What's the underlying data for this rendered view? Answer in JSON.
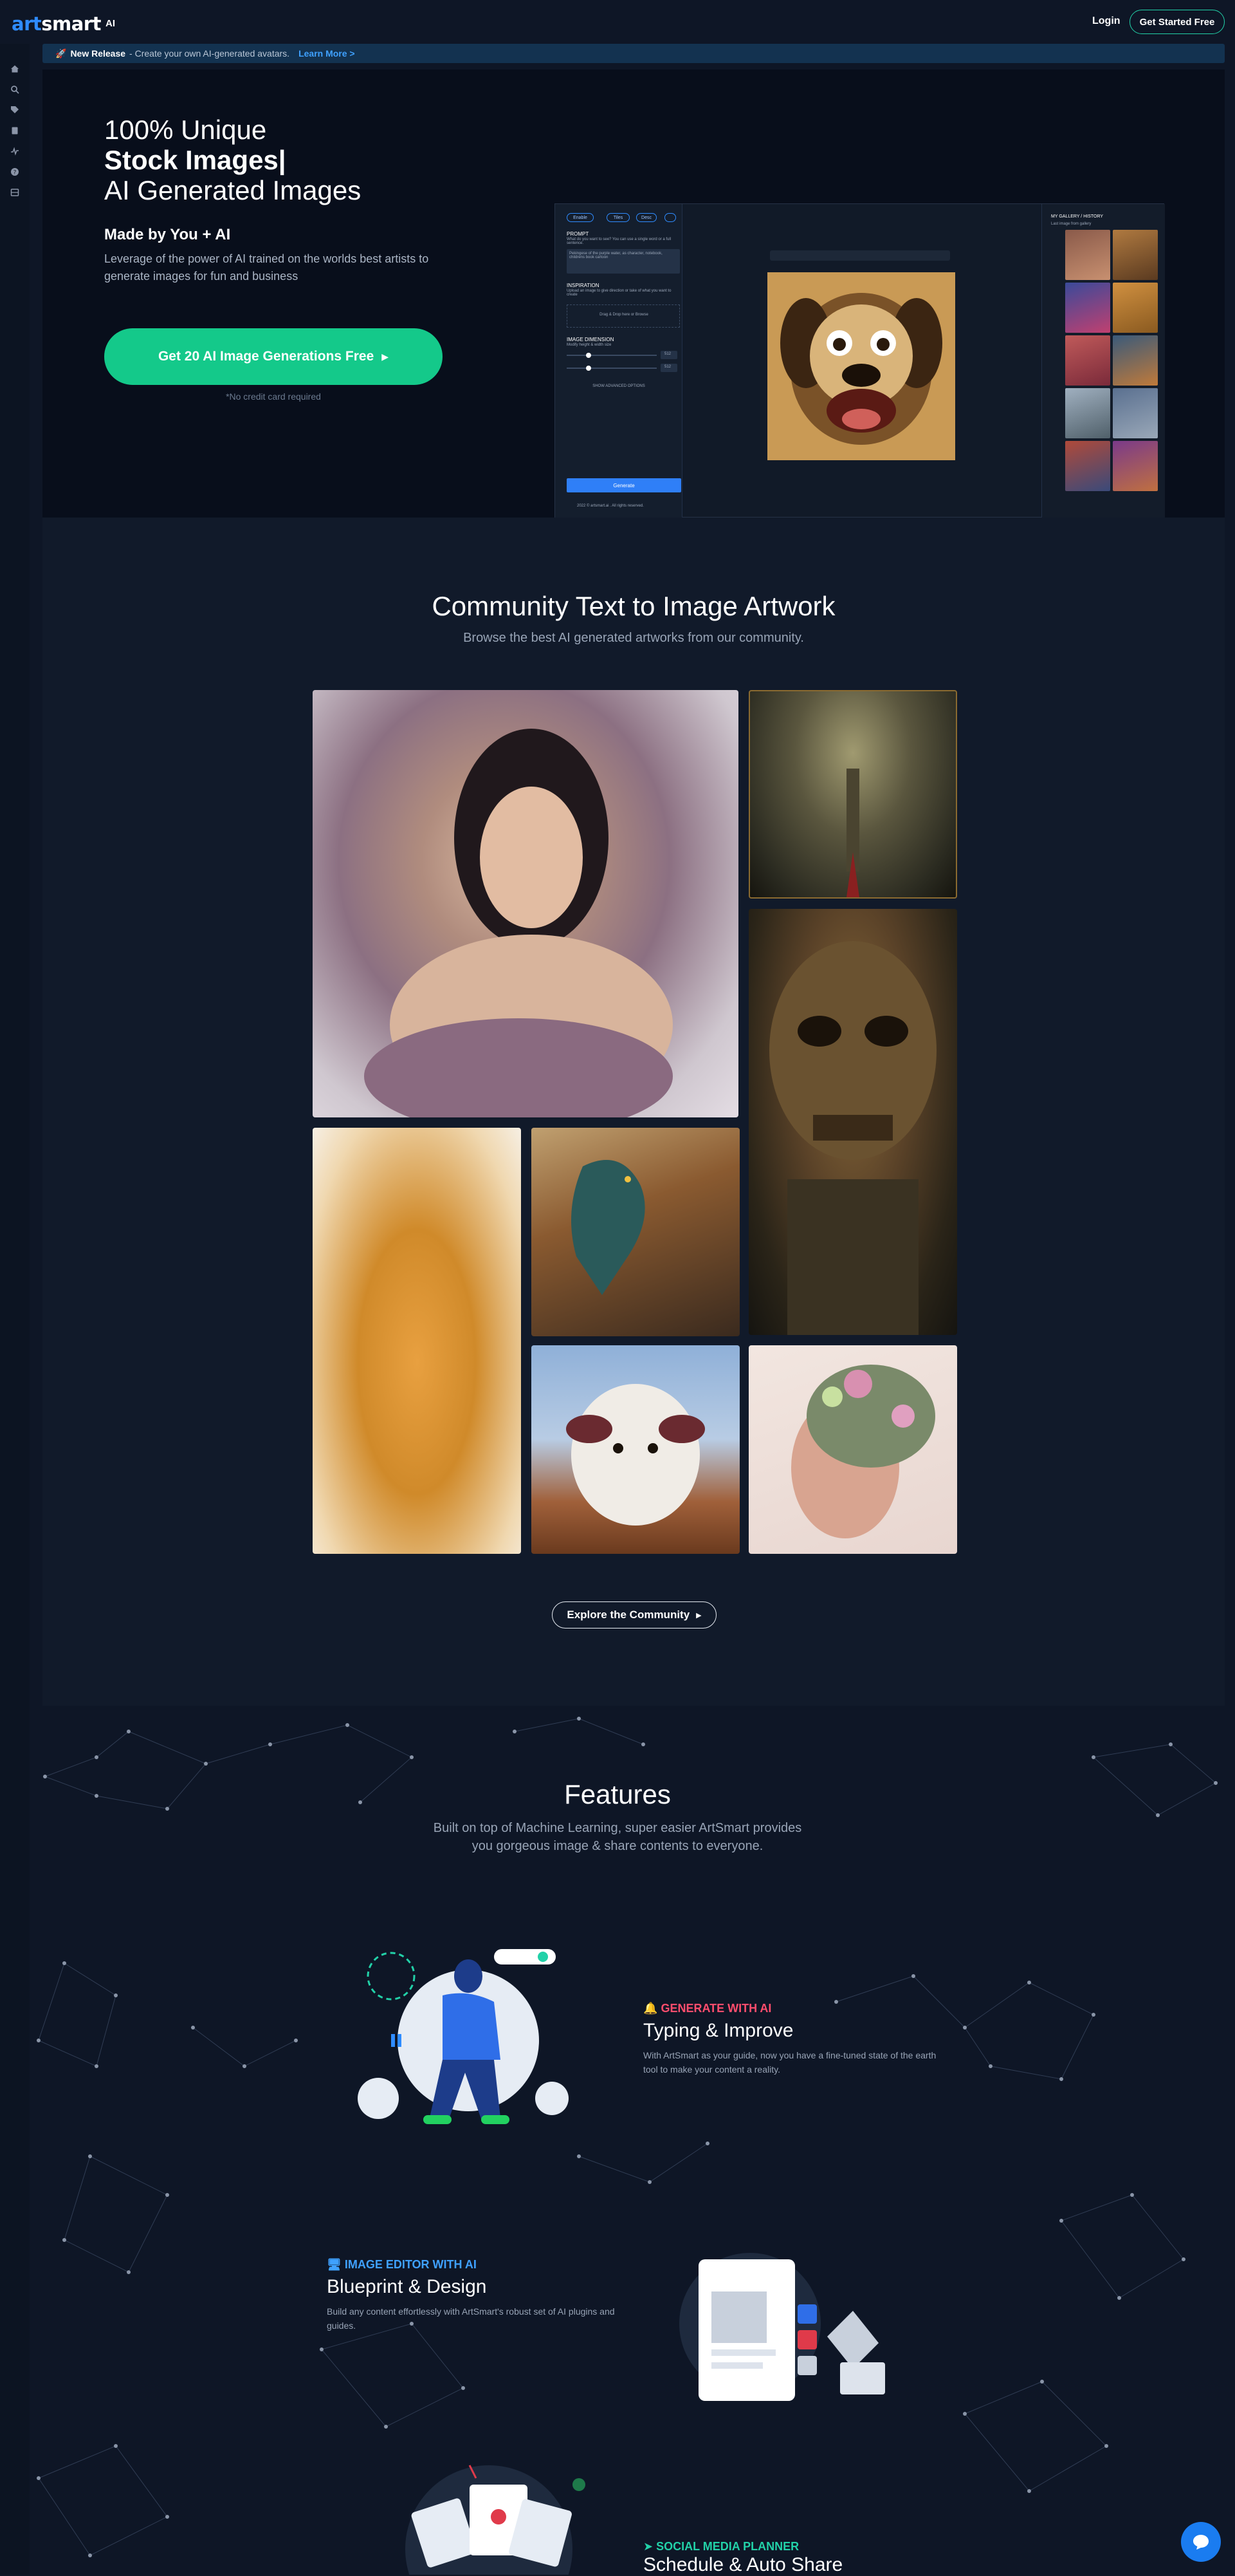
{
  "header": {
    "logo_part1": "art",
    "logo_part2": "smart",
    "logo_suffix": "AI",
    "login": "Login",
    "get_started": "Get Started Free"
  },
  "sidebar": {
    "icons": [
      "home-icon",
      "search-icon",
      "tag-icon",
      "book-icon",
      "activity-icon",
      "help-icon",
      "grid-icon"
    ]
  },
  "banner": {
    "icon": "rocket-icon",
    "new_release": "New Release",
    "text": "- Create your own AI-generated avatars.",
    "learn_more": "Learn More >"
  },
  "hero": {
    "line1": "100% Unique",
    "line2": "Stock Images|",
    "line3": "AI Generated Images",
    "made_by": "Made by You + AI",
    "description": "Leverage of the power of AI trained on the worlds best artists to generate images for fun and business",
    "cta": "Get 20 AI Image Generations Free",
    "no_card": "*No credit card required"
  },
  "app_mock": {
    "prompt_label": "PROMPT",
    "prompt_hint": "What do you want to see? You can use a single word or a full sentence.",
    "prompt_input": "Pekingese of the purple water, as character, notebook, childrens book cartoon",
    "inspiration_label": "INSPIRATION",
    "inspiration_hint": "Upload an image to give direction or take of what you want to create",
    "drop_text": "Drag & Drop here or Browse",
    "dimension_label": "IMAGE DIMENSION",
    "dimension_hint": "Modify height & width size",
    "dim1": "512",
    "dim2": "512",
    "advanced": "SHOW ADVANCED OPTIONS",
    "generate": "Generate",
    "footer": "2022 © artsmart.ai . All rights reserved.",
    "gallery_title": "MY GALLERY / HISTORY",
    "gallery_hint": "Last image from gallery",
    "tags": [
      "Enable",
      "Tiles",
      "Desc",
      ""
    ]
  },
  "community": {
    "title": "Community Text to Image Artwork",
    "subtitle": "Browse the best AI generated artworks from our community.",
    "explore": "Explore the Community"
  },
  "features": {
    "title": "Features",
    "subtitle": "Built on top of Machine Learning, super easier ArtSmart provides you gorgeous image & share contents to everyone.",
    "items": [
      {
        "label": "GENERATE WITH AI",
        "title": "Typing & Improve",
        "text": "With ArtSmart as your guide, now you have a fine-tuned state of the earth tool to make your content a reality.",
        "color": "#ff4d6d",
        "icon": "bell-icon"
      },
      {
        "label": "IMAGE EDITOR WITH AI",
        "title": "Blueprint & Design",
        "text": "Build any content effortlessly with ArtSmart's robust set of AI plugins and guides.",
        "color": "#3fa1ff",
        "icon": "devices-icon"
      },
      {
        "label": "SOCIAL MEDIA PLANNER",
        "title": "Schedule & Auto Share",
        "text": "",
        "color": "#22d1a8",
        "icon": "send-icon"
      }
    ]
  },
  "chat": {
    "icon": "chat-bubble-icon"
  }
}
